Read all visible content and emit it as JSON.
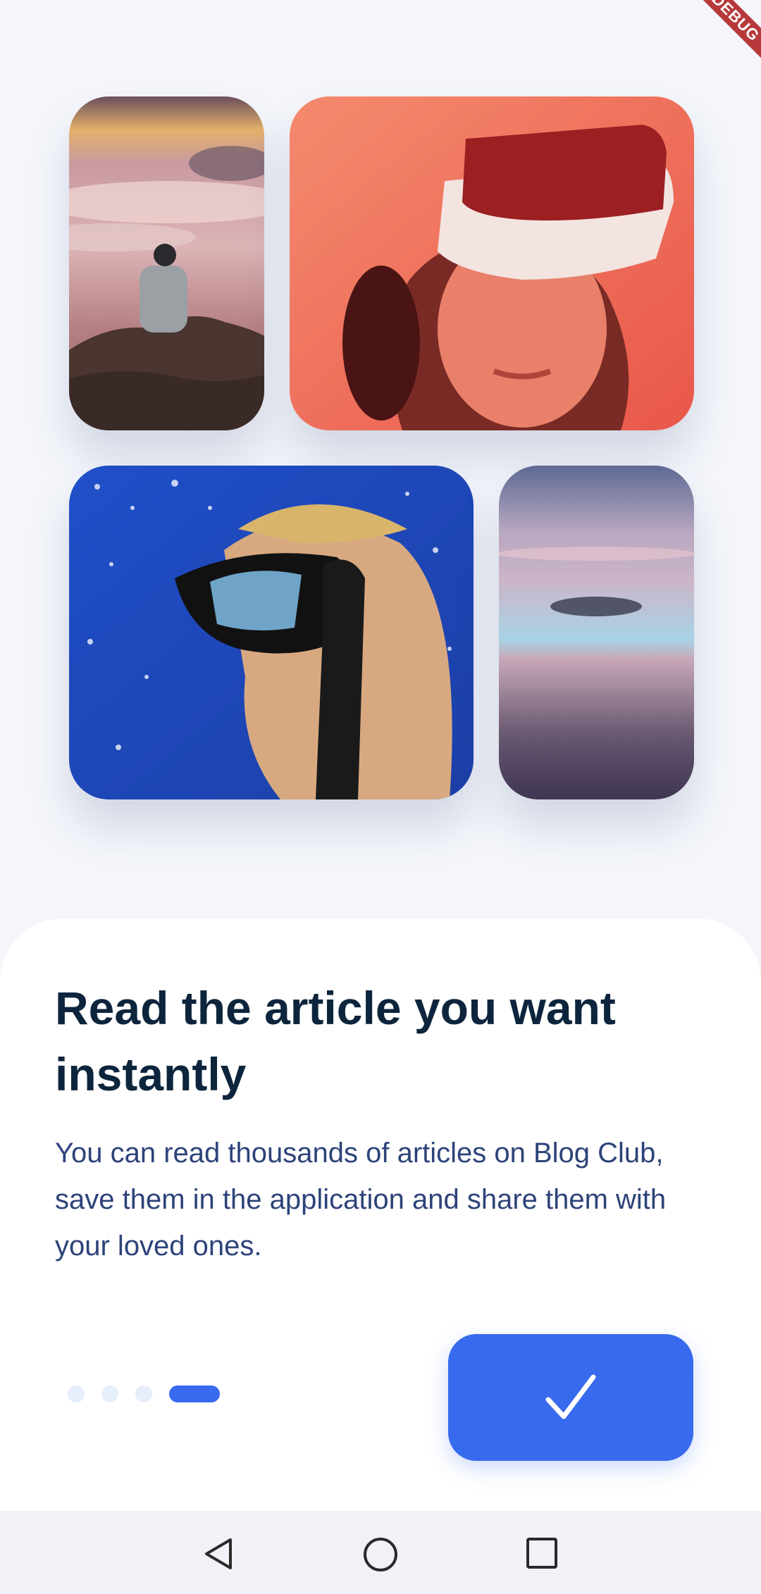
{
  "debug_banner": "DEBUG",
  "photos": [
    {
      "name": "mountain-clouds-photo",
      "subject": "person sitting on rock above clouds"
    },
    {
      "name": "vr-headset-photo",
      "subject": "person wearing VR headset"
    },
    {
      "name": "diver-photo",
      "subject": "diver with snorkel mask underwater"
    },
    {
      "name": "sea-sunset-photo",
      "subject": "calm sea at dusk"
    }
  ],
  "onboarding": {
    "title": "Read the article you want instantly",
    "description": "You can read thousands of articles on Blog Club, save them in the application and share them with your loved ones.",
    "page_indicator": {
      "total": 4,
      "current": 4
    },
    "next_button_icon": "check-icon"
  },
  "colors": {
    "primary": "#376aed",
    "title": "#0d253c",
    "body_text": "#2d4379",
    "inactive_dot": "#e6edfb"
  },
  "navigation_bar": {
    "icons": [
      "back-triangle-icon",
      "home-circle-icon",
      "recents-square-icon"
    ]
  }
}
